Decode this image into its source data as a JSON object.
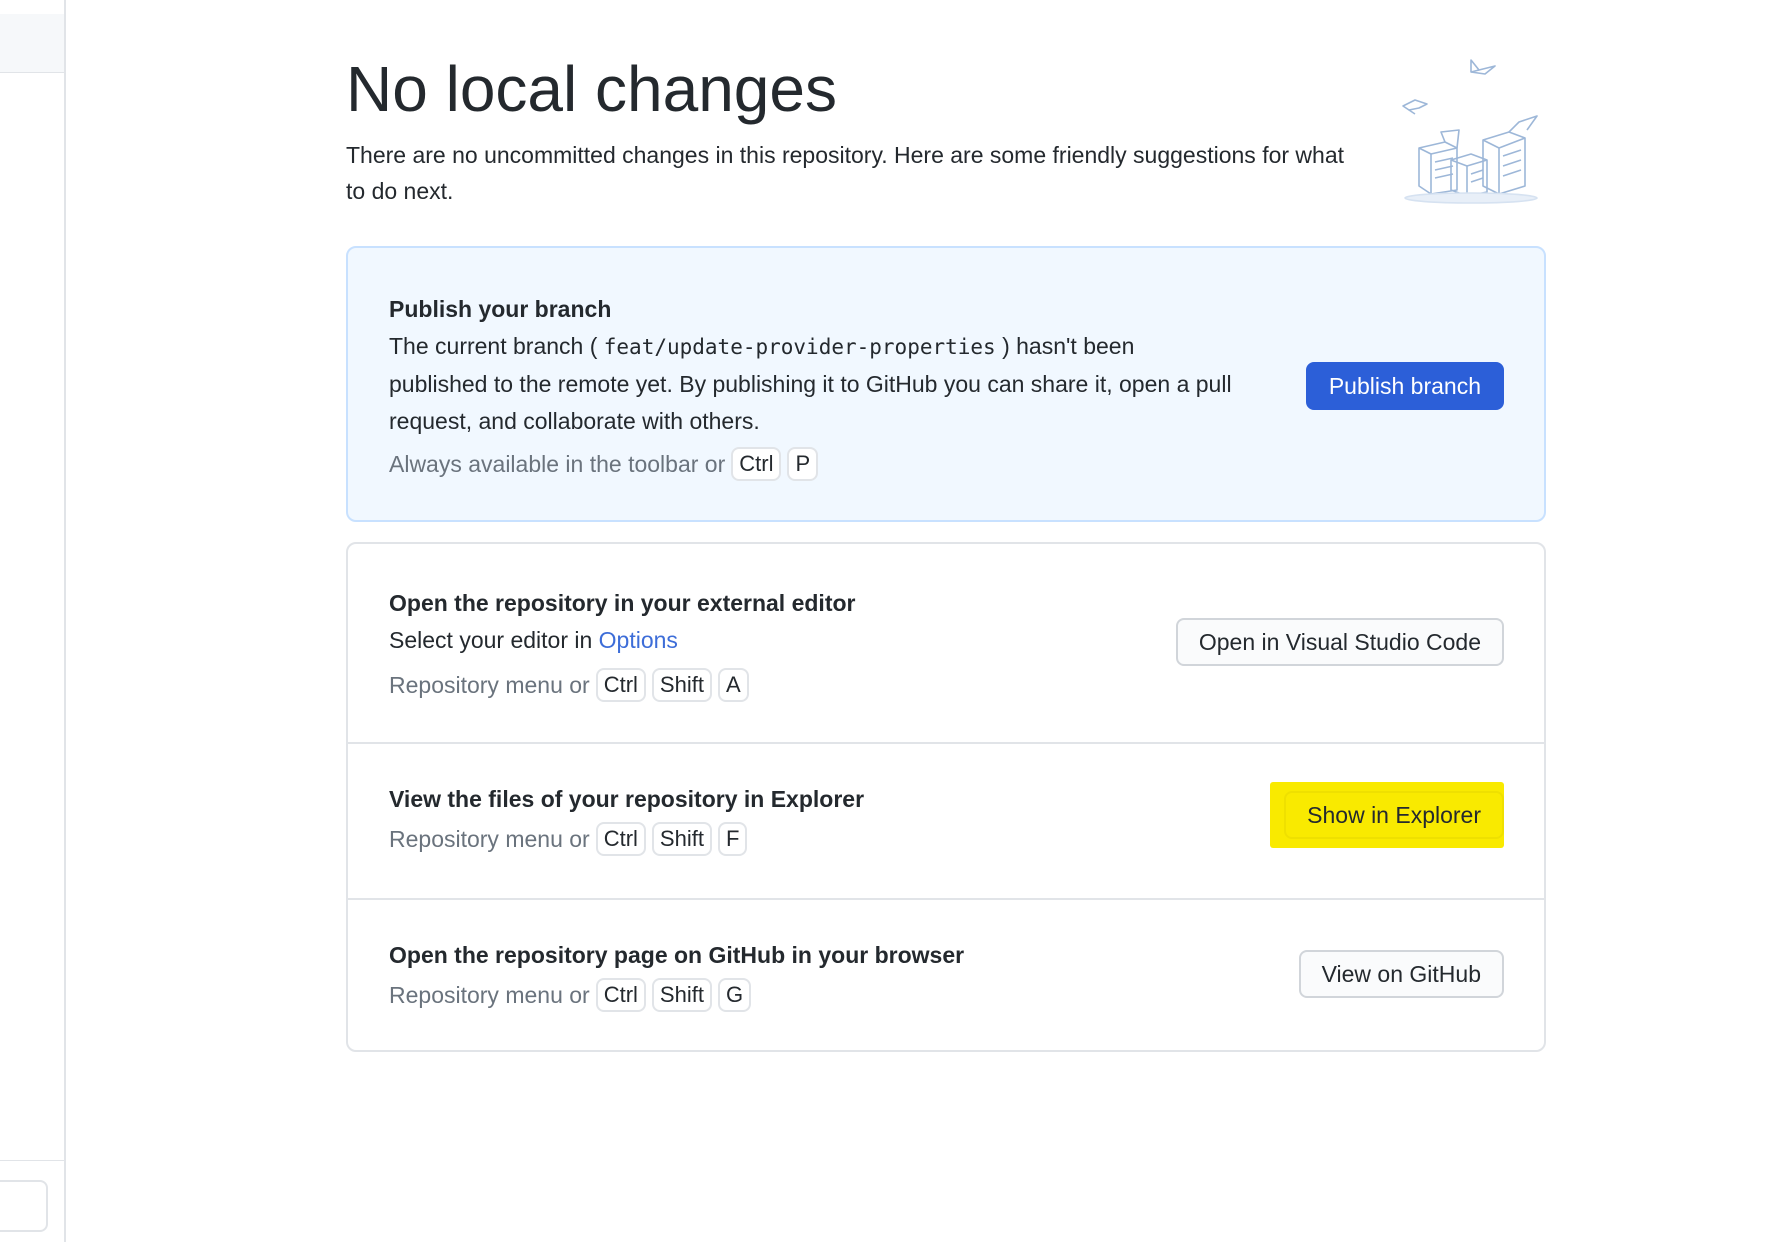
{
  "page": {
    "title": "No local changes",
    "subtitle": "There are no uncommitted changes in this repository. Here are some friendly suggestions for what to do next."
  },
  "illustration": {
    "icon": "empty-boxes-illustration"
  },
  "publish": {
    "title": "Publish your branch",
    "desc_prefix": "The current branch ( ",
    "branch_name": "feat/update-provider-properties",
    "desc_suffix": " ) hasn't been published to the remote yet. By publishing it to GitHub you can share it, open a pull request, and collaborate with others.",
    "hint": "Always available in the toolbar or",
    "keys": [
      "Ctrl",
      "P"
    ],
    "button_label": "Publish branch"
  },
  "editor": {
    "title": "Open the repository in your external editor",
    "desc_prefix": "Select your editor in ",
    "desc_link": "Options",
    "hint": "Repository menu or",
    "keys": [
      "Ctrl",
      "Shift",
      "A"
    ],
    "button_label": "Open in Visual Studio Code"
  },
  "explorer": {
    "title": "View the files of your repository in Explorer",
    "hint": "Repository menu or",
    "keys": [
      "Ctrl",
      "Shift",
      "F"
    ],
    "button_label": "Show in Explorer"
  },
  "github": {
    "title": "Open the repository page on GitHub in your browser",
    "hint": "Repository menu or",
    "keys": [
      "Ctrl",
      "Shift",
      "G"
    ],
    "button_label": "View on GitHub"
  },
  "colors": {
    "primary_button": "#2c5fd8",
    "highlight": "#f9ea00",
    "link": "#3d6dd8"
  }
}
